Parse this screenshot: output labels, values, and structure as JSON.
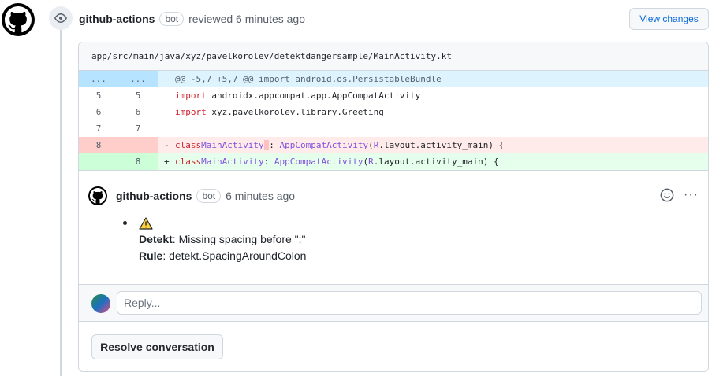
{
  "review": {
    "author": "github-actions",
    "badge": "bot",
    "action_text": "reviewed 6 minutes ago",
    "view_changes_label": "View changes"
  },
  "file": {
    "path": "app/src/main/java/xyz/pavelkorolev/detektdangersample/MainActivity.kt"
  },
  "diff": {
    "hunk": {
      "left": "...",
      "right": "...",
      "text": "@@ -5,7 +5,7 @@ import android.os.PersistableBundle"
    },
    "context_rows": [
      {
        "left": "5",
        "right": "5",
        "keyword": "import",
        "rest": " androidx.appcompat.app.AppCompatActivity"
      },
      {
        "left": "6",
        "right": "6",
        "keyword": "import",
        "rest": " xyz.pavelkorolev.library.Greeting"
      },
      {
        "left": "7",
        "right": "7",
        "keyword": "",
        "rest": ""
      }
    ],
    "deleted": {
      "left": "8",
      "sign": "-",
      "kw": "class",
      "name": "MainActivity",
      "highlight": " ",
      "colon": ": ",
      "super": "AppCompatActivity",
      "open": "(",
      "r": "R",
      "tail": ".layout.activity_main) {"
    },
    "added": {
      "right": "8",
      "sign": "+",
      "kw": "class",
      "name": "MainActivity",
      "colon": ": ",
      "super": "AppCompatActivity",
      "open": "(",
      "r": "R",
      "tail": ".layout.activity_main) {"
    }
  },
  "comment": {
    "author": "github-actions",
    "badge": "bot",
    "time": "6 minutes ago",
    "warning_icon": "warning-icon",
    "detekt_label": "Detekt",
    "detekt_text": ": Missing spacing before \":\"",
    "rule_label": "Rule",
    "rule_text": ": detekt.SpacingAroundColon",
    "more_label": "···"
  },
  "reply": {
    "placeholder": "Reply..."
  },
  "resolve": {
    "label": "Resolve conversation"
  }
}
